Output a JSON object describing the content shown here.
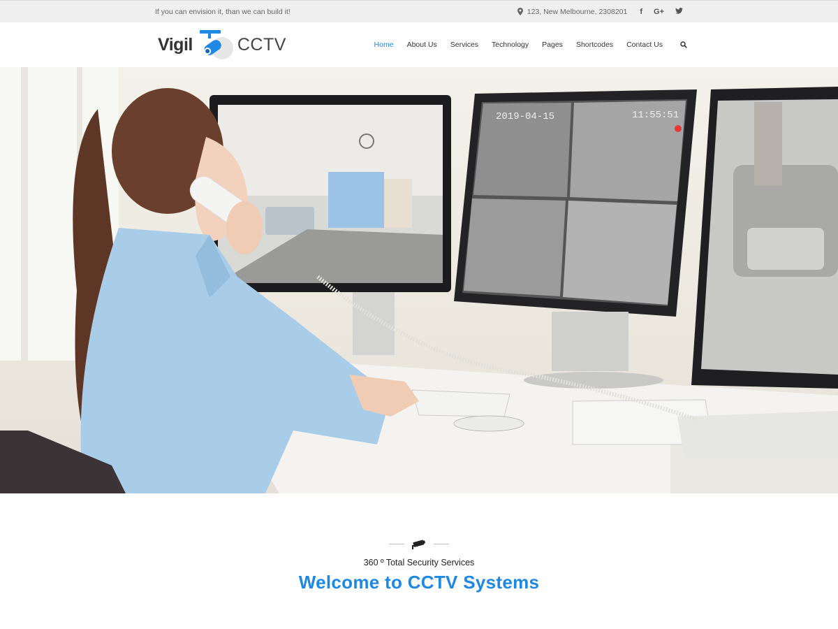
{
  "topbar": {
    "tagline": "If you can envision it, than we can build it!",
    "address": "123, New Melbourne, 2308201",
    "social": [
      "f",
      "G+",
      "t"
    ]
  },
  "logo": {
    "part1": "Vigil",
    "part2": "CCTV"
  },
  "nav": {
    "items": [
      "Home",
      "About Us",
      "Services",
      "Technology",
      "Pages",
      "Shortcodes",
      "Contact Us"
    ],
    "active": "Home"
  },
  "hero": {
    "monitor_timestamp": "2019-04-15",
    "monitor_clock": "11:55:51"
  },
  "welcome": {
    "subtitle": "360 º Total Security Services",
    "title": "Welcome to CCTV Systems"
  },
  "colors": {
    "accent": "#1e88e5",
    "topbar_bg": "#efefef"
  }
}
